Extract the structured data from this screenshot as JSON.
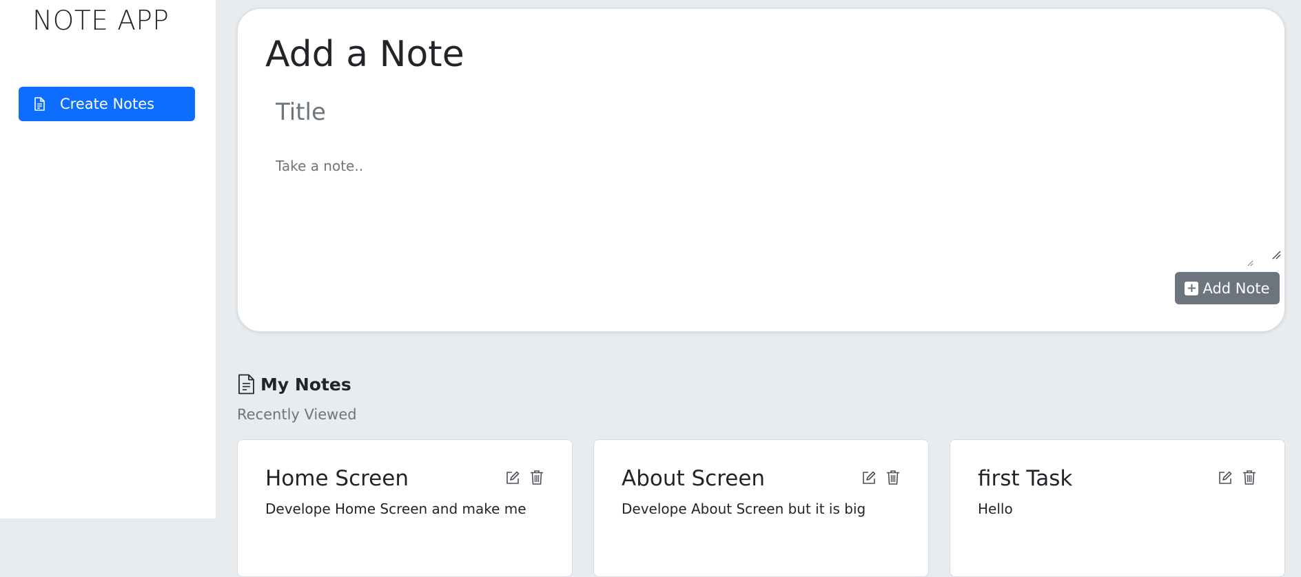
{
  "app": {
    "title": "NOTE APP"
  },
  "sidebar": {
    "items": [
      {
        "label": "Create Notes",
        "icon": "document-icon"
      }
    ]
  },
  "add_note": {
    "heading": "Add a Note",
    "title_placeholder": "Title",
    "title_value": "",
    "note_placeholder": "Take a note..",
    "note_value": "",
    "button_label": "Add Note"
  },
  "notes_section": {
    "title": "My Notes",
    "subtitle": "Recently Viewed"
  },
  "notes": [
    {
      "title": "Home Screen",
      "body": "Develope Home Screen and make me"
    },
    {
      "title": "About Screen",
      "body": "Develope About Screen but it is big"
    },
    {
      "title": "first Task",
      "body": "Hello"
    }
  ],
  "colors": {
    "primary": "#0d6efd",
    "secondary": "#6c757d",
    "background": "#e9ecef",
    "card": "#ffffff"
  }
}
